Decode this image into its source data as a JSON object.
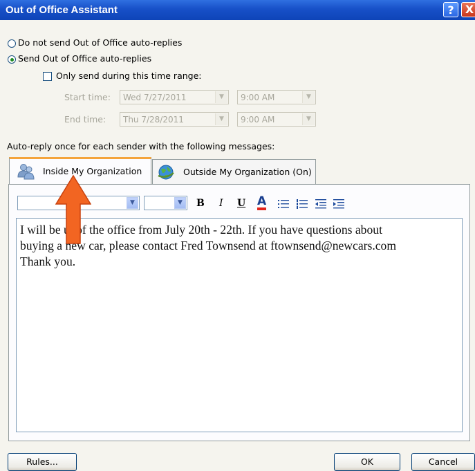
{
  "window": {
    "title": "Out of Office Assistant",
    "help_glyph": "?",
    "close_glyph": "X"
  },
  "options": {
    "do_not_send_label": "Do not send Out of Office auto-replies",
    "send_label": "Send Out of Office auto-replies",
    "selected": "send",
    "time_range_label": "Only send during this time range:",
    "time_range_checked": false,
    "start_time_label": "Start time:",
    "start_date": "Wed 7/27/2011",
    "start_clock": "9:00 AM",
    "end_time_label": "End time:",
    "end_date": "Thu 7/28/2011",
    "end_clock": "9:00 AM"
  },
  "auto_reply": {
    "instruction": "Auto-reply once for each sender with the following messages:",
    "tabs": [
      {
        "label": "Inside My Organization",
        "icon": "people-icon",
        "active": true
      },
      {
        "label": "Outside My Organization (On)",
        "icon": "globe-icon",
        "active": false
      }
    ]
  },
  "toolbar": {
    "font_name": "",
    "font_size": "",
    "bold": "B",
    "italic": "I",
    "underline": "U",
    "font_color": "A",
    "icons": [
      "bullets-icon",
      "numbering-icon",
      "decrease-indent-icon",
      "increase-indent-icon"
    ]
  },
  "message": {
    "line1": "I will be  ut of the office from July 20th - 22th.  If you have questions about",
    "line2": "buying a new car, please contact Fred Townsend at ftownsend@newcars.com",
    "line3": "Thank you."
  },
  "buttons": {
    "rules": "Rules...",
    "ok": "OK",
    "cancel": "Cancel"
  },
  "colors": {
    "titlebar": "#1750c8",
    "accent_tab": "#f4a43b",
    "annotation_arrow": "#f26522"
  }
}
